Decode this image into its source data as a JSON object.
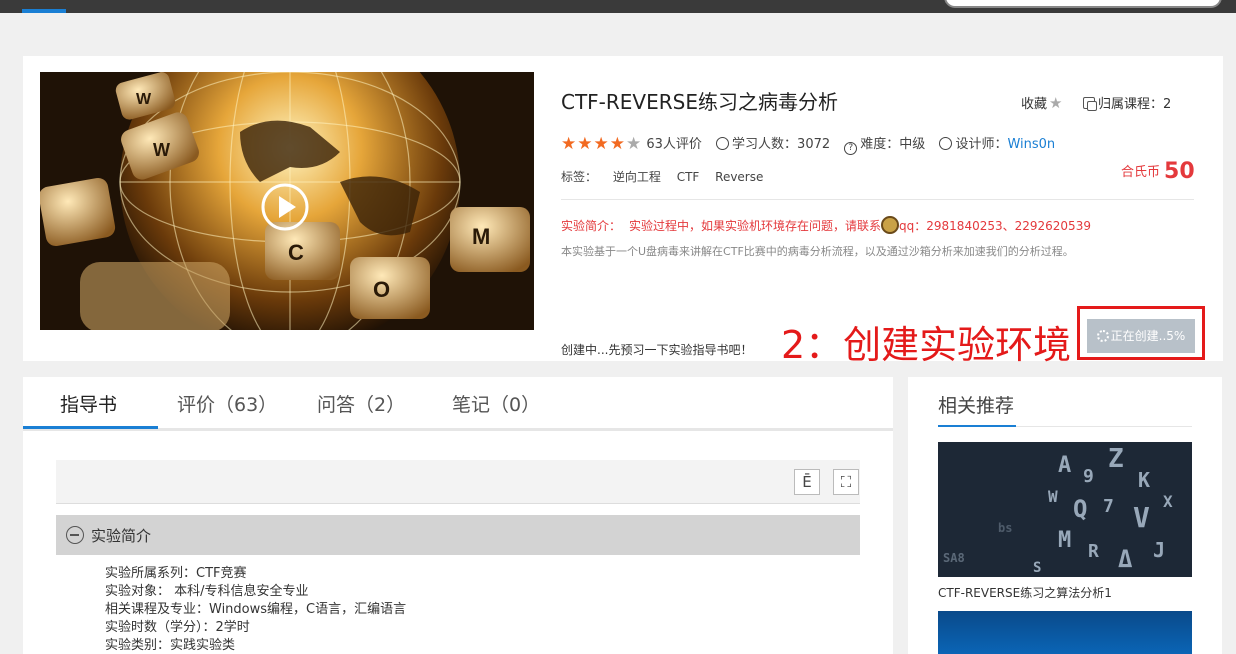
{
  "course": {
    "title": "CTF-REVERSE练习之病毒分析",
    "favorite_label": "收藏",
    "belongs_label": "归属课程：2",
    "rating_count": "63人评价",
    "learners": "学习人数：3072",
    "difficulty": "难度：中级",
    "designer_label": "设计师：",
    "designer_name": "Wins0n",
    "tags_label": "标签：",
    "tags": [
      "逆向工程",
      "CTF",
      "Reverse"
    ],
    "coins_label": "合氏币",
    "coins_value": "50",
    "intro_label": "实验简介：",
    "intro_notice": "实验过程中，如果实验机环境存在问题，请联系",
    "intro_qq": "qq：2981840253、2292620539",
    "description": "本实验基于一个U盘病毒来讲解在CTF比赛中的病毒分析流程，以及通过沙箱分析来加速我们的分析过程。",
    "creating_hint": "创建中...先预习一下实验指导书吧！",
    "annotation": "2：创建实验环境",
    "creating_button": "正在创建..5%",
    "rating": 4.5
  },
  "thumbnail": {
    "key_letters": [
      "W",
      "C",
      "O",
      "M"
    ]
  },
  "tabs": [
    {
      "label": "指导书"
    },
    {
      "label": "评价（63）"
    },
    {
      "label": "问答（2）"
    },
    {
      "label": "笔记（0）"
    }
  ],
  "guide": {
    "section_title": "实验简介",
    "info_lines": [
      "实验所属系列：CTF竞赛",
      "实验对象： 本科/专科信息安全专业",
      "相关课程及专业：Windows编程，C语言，汇编语言",
      "实验时数（学分）：2学时",
      "实验类别：实践实验类"
    ]
  },
  "sidebar": {
    "title": "相关推荐",
    "items": [
      {
        "title": "CTF-REVERSE练习之算法分析1"
      }
    ]
  },
  "colors": {
    "accent": "#1a7fd4",
    "red": "#e4393c",
    "star": "#f26a21"
  }
}
